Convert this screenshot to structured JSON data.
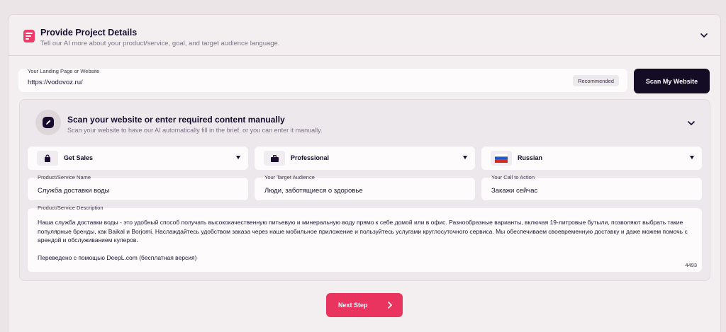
{
  "header": {
    "title": "Provide Project Details",
    "subtitle": "Tell our AI more about your product/service, goal, and target audience language."
  },
  "url_field": {
    "label": "Your Landing Page or Website",
    "value": "https://vodovoz.ru/",
    "badge": "Recommended"
  },
  "scan_button": "Scan My Website",
  "scan_section": {
    "title": "Scan your website or enter required content manually",
    "subtitle": "Scan your website to have our AI automatically fill in the brief, or you can enter it manually."
  },
  "selects": {
    "goal": "Get Sales",
    "tone": "Professional",
    "language": "Russian"
  },
  "fields": {
    "product_name": {
      "label": "Product/Service Name",
      "value": "Служба доставки воды"
    },
    "target_audience": {
      "label": "Your Target Audience",
      "value": "Люди, заботящиеся о здоровье"
    },
    "call_to_action": {
      "label": "Your Call to Action",
      "value": "Закажи сейчас"
    }
  },
  "description": {
    "label": "Product/Service Description",
    "paragraph1": "Наша служба доставки воды - это удобный способ получать высококачественную питьевую и минеральную воду прямо к себе домой или в офис. Разнообразные варианты, включая 19-литровые бутыли, позволяют выбрать такие популярные бренды, как Baikal и Borjomi. Наслаждайтесь удобством заказа через наше мобильное приложение и пользуйтесь услугами круглосуточного сервиса. Мы обеспечиваем своевременную доставку и даже можем помочь с арендой и обслуживанием кулеров.",
    "paragraph2": "Переведено с помощью DeepL.com (бесплатная версия)",
    "counter": "4493"
  },
  "next_button": "Next Step",
  "colors": {
    "accent": "#e8345f",
    "dark": "#140c25",
    "background": "#ebe5e8"
  },
  "icons": {
    "header": "form-icon",
    "section": "pen-icon",
    "goal": "shopping-bag-icon",
    "tone": "briefcase-icon",
    "language": "russia-flag-icon",
    "collapse": "chevron-down-icon",
    "next": "chevron-right-icon"
  }
}
